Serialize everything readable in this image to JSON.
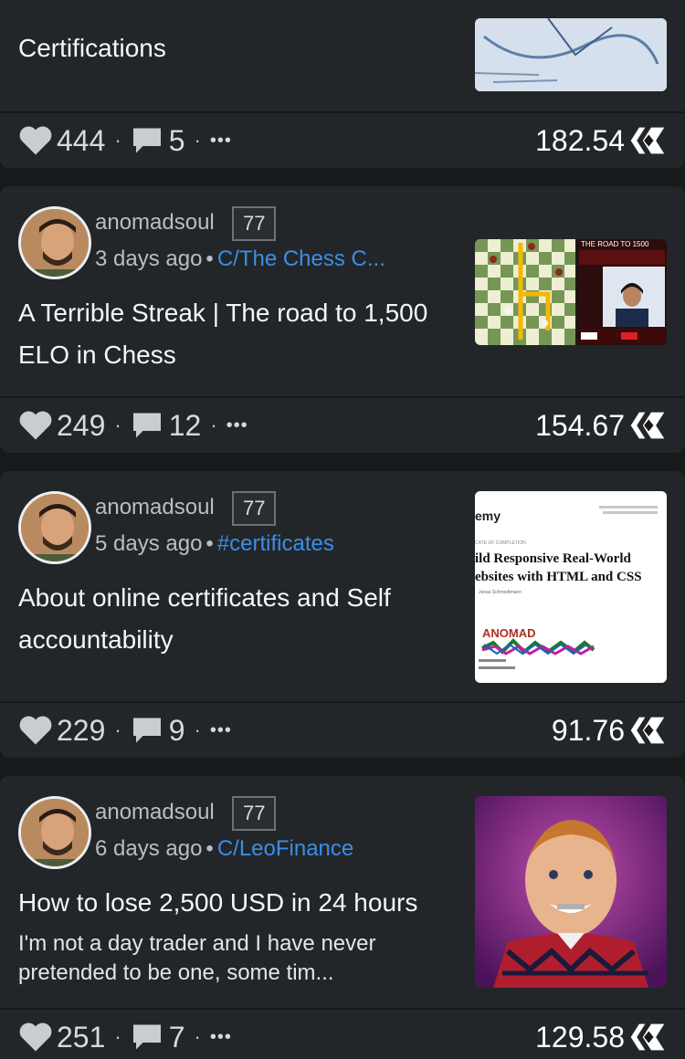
{
  "top_card": {
    "title": "Certifications",
    "likes": "444",
    "comments": "5",
    "more": "•••",
    "payout": "182.54"
  },
  "posts": [
    {
      "author": "anomadsoul",
      "reputation": "77",
      "time": "3 days ago",
      "community": "C/The Chess C...",
      "title": "A Terrible Streak | The road to 1,500 ELO in Chess",
      "excerpt": "",
      "likes": "249",
      "comments": "12",
      "more": "•••",
      "payout": "154.67",
      "thumb_text": "THE ROAD TO 1500"
    },
    {
      "author": "anomadsoul",
      "reputation": "77",
      "time": "5 days ago",
      "community": "#certificates",
      "title": "About online certificates and Self accountability",
      "excerpt": "",
      "likes": "229",
      "comments": "9",
      "more": "•••",
      "payout": "91.76",
      "thumb_text": {
        "brand": "emy",
        "cert_label": "CATE OF COMPLETION",
        "course_line1": "ild Responsive Real-World",
        "course_line2": "ebsites with HTML and CSS",
        "instructor": "Jonas Schmedtmann",
        "signature": "ANOMAD"
      }
    },
    {
      "author": "anomadsoul",
      "reputation": "77",
      "time": "6 days ago",
      "community": "C/LeoFinance",
      "title": "How to lose 2,500 USD in 24 hours",
      "excerpt": "I'm not a day trader and I have never pretended to be one, some tim...",
      "likes": "251",
      "comments": "7",
      "more": "•••",
      "payout": "129.58"
    }
  ],
  "separator": "·",
  "meta_dot": "•",
  "icons": {
    "like": "heart-icon",
    "comment": "comment-bubble-icon",
    "more": "more-dots-icon",
    "currency": "hive-logo-icon"
  },
  "colors": {
    "background": "#17191b",
    "card": "#232629",
    "link": "#3a8ee6",
    "text": "#eceff1"
  }
}
